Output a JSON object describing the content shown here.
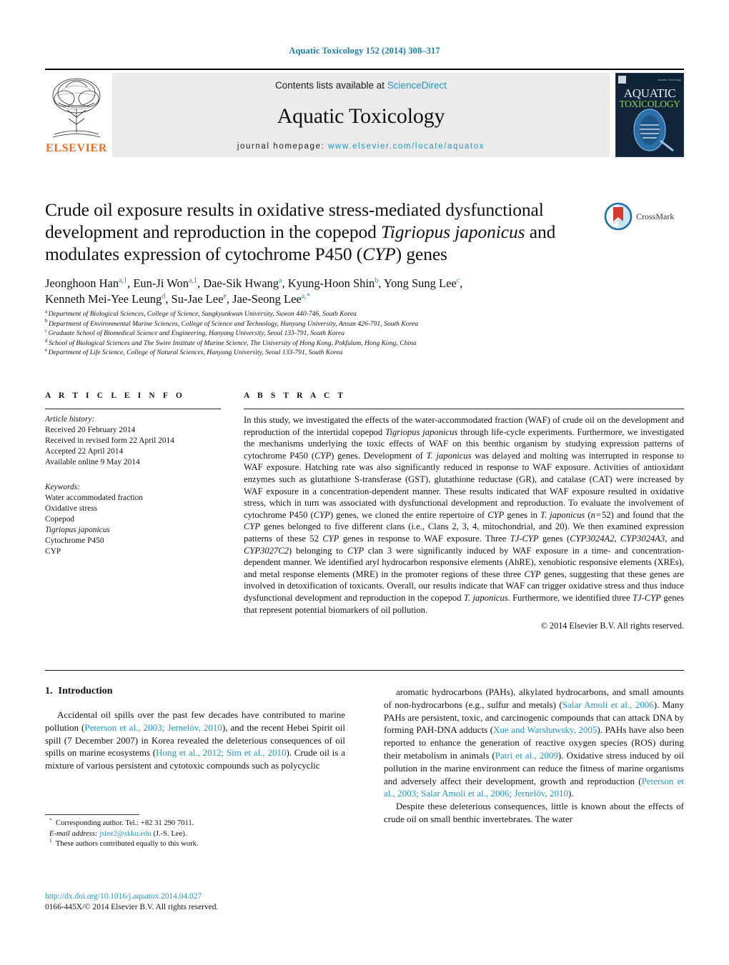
{
  "running_head": "Aquatic Toxicology 152 (2014) 308–317",
  "masthead": {
    "contents_prefix": "Contents lists available at ",
    "sciencedirect": "ScienceDirect",
    "journal_title": "Aquatic Toxicology",
    "homepage_prefix": "journal homepage:",
    "homepage_url": "www.elsevier.com/locate/aquatox",
    "publisher_wordmark": "ELSEVIER",
    "cover": {
      "line1": "AQUATIC",
      "line2": "TOXICOLOGY",
      "masthead_small": "Aquatic Toxicology"
    },
    "link_color": "#2196c4"
  },
  "title": {
    "line1": "Crude oil exposure results in oxidative stress-mediated dysfunctional",
    "line2_a": "development and reproduction in the copepod ",
    "line2_italic": "Tigriopus japonicus",
    "line2_b": " and",
    "line3_a": "modulates expression of cytochrome P450 (",
    "line3_italic": "CYP",
    "line3_b": ") genes"
  },
  "crossmark": {
    "label": "CrossMark"
  },
  "authors": {
    "line1": "Jeonghoon Han",
    "sup1": "a,1",
    "line1b": ", Eun-Ji Won",
    "sup2": "a,1",
    "line1c": ", Dae-Sik Hwang",
    "sup3": "a",
    "line1d": ", Kyung-Hoon Shin",
    "sup4": "b",
    "line1e": ", Yong Sung Lee",
    "sup5": "c",
    "line1f": ",",
    "line2a": "Kenneth Mei-Yee Leung",
    "sup6": "d",
    "line2b": ", Su-Jae Lee",
    "sup7": "e",
    "line2c": ", Jae-Seong Lee",
    "sup8": "a,*"
  },
  "affiliations": [
    {
      "marker": "a",
      "text": "Department of Biological Sciences, College of Science, Sungkyunkwan University, Suwon 440-746, South Korea"
    },
    {
      "marker": "b",
      "text": "Department of Environmental Marine Sciences, College of Science and Technology, Hanyang University, Ansan 426-791, South Korea"
    },
    {
      "marker": "c",
      "text": "Graduate School of Biomedical Science and Engineering, Hanyang University, Seoul 133-791, South Korea"
    },
    {
      "marker": "d",
      "text": "School of Biological Sciences and The Swire Institute of Marine Science, The University of Hong Kong, Pokfulam, Hong Kong, China"
    },
    {
      "marker": "e",
      "text": "Department of Life Science, College of Natural Sciences, Hanyang University, Seoul 133-791, South Korea"
    }
  ],
  "article_info": {
    "heading": "A R T I C L E  I N F O",
    "history_label": "Article history:",
    "history": [
      "Received 20 February 2014",
      "Received in revised form 22 April 2014",
      "Accepted 22 April 2014",
      "Available online 9 May 2014"
    ],
    "keywords_label": "Keywords:",
    "keywords": [
      {
        "text": "Water accommodated fraction",
        "italic": false
      },
      {
        "text": "Oxidative stress",
        "italic": false
      },
      {
        "text": "Copepod",
        "italic": false
      },
      {
        "text": "Tigriopus japonicus",
        "italic": true
      },
      {
        "text": "Cytochrome P450",
        "italic": false
      },
      {
        "text": "CYP",
        "italic": false
      }
    ]
  },
  "abstract": {
    "heading": "A B S T R A C T",
    "body_html": "In this study, we investigated the effects of the water-accommodated fraction (WAF) of crude oil on the development and reproduction of the intertidal copepod <i>Tigriopus japonicus</i> through life-cycle experiments. Furthermore, we investigated the mechanisms underlying the toxic effects of WAF on this benthic organism by studying expression patterns of cytochrome P450 (<i>CYP</i>) genes. Development of <i>T. japonicus</i> was delayed and molting was interrupted in response to WAF exposure. Hatching rate was also significantly reduced in response to WAF exposure. Activities of antioxidant enzymes such as glutathione S-transferase (GST), glutathione reductase (GR), and catalase (CAT) were increased by WAF exposure in a concentration-dependent manner. These results indicated that WAF exposure resulted in oxidative stress, which in turn was associated with dysfunctional development and reproduction. To evaluate the involvement of cytochrome P450 (<i>CYP</i>) genes, we cloned the entire repertoire of <i>CYP</i> genes in <i>T. japonicus</i> (<i>n</i>&#8202;=&#8202;52) and found that the <i>CYP</i> genes belonged to five different clans (i.e., Clans 2, 3, 4, mitochondrial, and 20). We then examined expression patterns of these 52 <i>CYP</i> genes in response to WAF exposure. Three <i>TJ-CYP</i> genes (<i>CYP3024A2</i>, <i>CYP3024A3</i>, and <i>CYP3027C2</i>) belonging to <i>CYP</i> clan 3 were significantly induced by WAF exposure in a time- and concentration-dependent manner. We identified aryl hydrocarbon responsive elements (AhRE), xenobiotic responsive elements (XREs), and metal response elements (MRE) in the promoter regions of these three <i>CYP</i> genes, suggesting that these genes are involved in detoxification of toxicants. Overall, our results indicate that WAF can trigger oxidative stress and thus induce dysfunctional development and reproduction in the copepod <i>T. japonicus</i>. Furthermore, we identified three <i>TJ-CYP</i> genes that represent potential biomarkers of oil pollution.",
    "copyright": "© 2014 Elsevier B.V. All rights reserved."
  },
  "introduction": {
    "number": "1.",
    "heading": "Introduction",
    "left_para_html": "Accidental oil spills over the past few decades have contributed to marine pollution (<span class=\"cite\">Peterson et al., 2003; Jernelöv, 2010</span>), and the recent Hebei Spirit oil spill (7 December 2007) in Korea revealed the deleterious consequences of oil spills on marine ecosystems (<span class=\"cite\">Hong et al., 2012; Sim et al., 2010</span>). Crude oil is a mixture of various persistent and cytotoxic compounds such as polycyclic",
    "right_para1_html": "aromatic hydrocarbons (PAHs), alkylated hydrocarbons, and small amounts of non-hydrocarbons (e.g., sulfur and metals) (<span class=\"cite\">Salar Amoli et al., 2006</span>). Many PAHs are persistent, toxic, and carcinogenic compounds that can attack DNA by forming PAH-DNA adducts (<span class=\"cite\">Xue and Warshawsky, 2005</span>). PAHs have also been reported to enhance the generation of reactive oxygen species (ROS) during their metabolism in animals (<span class=\"cite\">Patri et al., 2009</span>). Oxidative stress induced by oil pollution in the marine environment can reduce the fitness of marine organisms and adversely affect their development, growth and reproduction (<span class=\"cite\">Peterson et al., 2003; Salar Amoli et al., 2006; Jernelöv, 2010</span>).",
    "right_para2_html": "Despite these deleterious consequences, little is known about the effects of crude oil on small benthic invertebrates. The water"
  },
  "footnotes": {
    "corresponding_html": "<sup>*</sup>&nbsp; Corresponding author. Tel.: +82 31 290 7011.",
    "email_html": "<i>E-mail address:</i> <span class=\"mail\">jslee2@skku.edu</span> (J.-S. Lee).",
    "equal_html": "<sup>1</sup>&nbsp; These authors contributed equally to this work."
  },
  "doi": {
    "url": "http://dx.doi.org/10.1016/j.aquatox.2014.04.027",
    "copyright_line": "0166-445X/© 2014 Elsevier B.V. All rights reserved."
  }
}
